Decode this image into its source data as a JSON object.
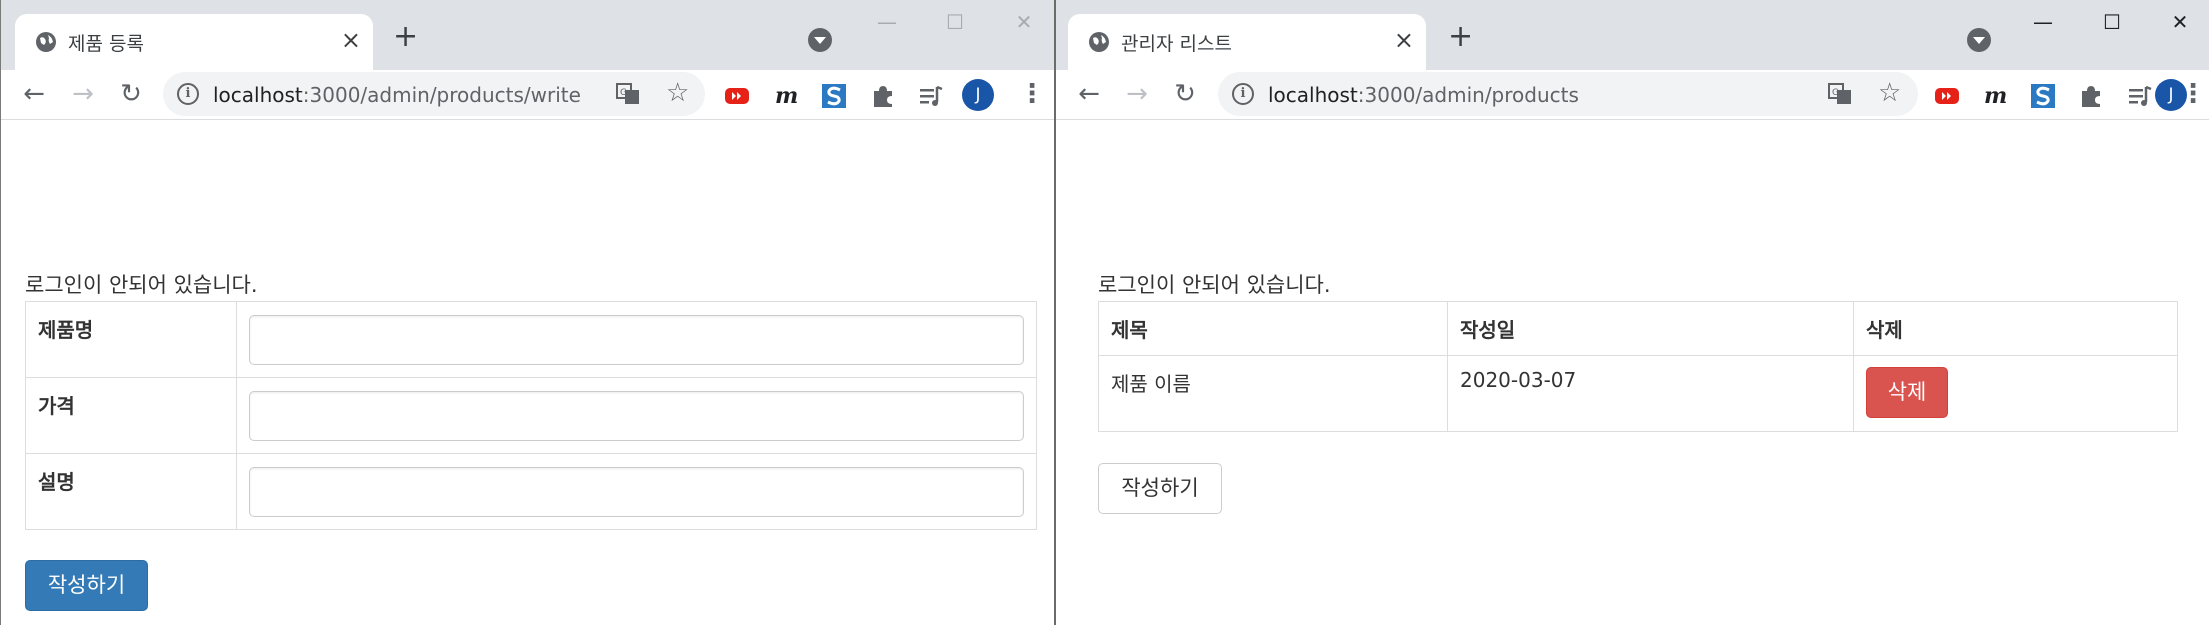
{
  "left_window": {
    "tab": {
      "title": "제품 등록",
      "close": "×"
    },
    "new_tab": "+",
    "window_controls": {
      "minimize": "—",
      "maximize": "☐",
      "close": "✕"
    },
    "url": {
      "host": "localhost",
      "path": ":3000/admin/products/write"
    },
    "avatar": "J",
    "login_message": "로그인이 안되어 있습니다.",
    "form": {
      "rows": [
        {
          "label": "제품명",
          "value": ""
        },
        {
          "label": "가격",
          "value": ""
        },
        {
          "label": "설명",
          "value": ""
        }
      ],
      "submit_label": "작성하기"
    }
  },
  "right_window": {
    "tab": {
      "title": "관리자 리스트",
      "close": "×"
    },
    "new_tab": "+",
    "window_controls": {
      "minimize": "—",
      "maximize": "☐",
      "close": "✕"
    },
    "url": {
      "host": "localhost",
      "path": ":3000/admin/products"
    },
    "avatar": "J",
    "login_message": "로그인이 안되어 있습니다.",
    "table": {
      "headers": [
        "제목",
        "작성일",
        "삭제"
      ],
      "rows": [
        {
          "title": "제품 이름",
          "date": "2020-03-07",
          "delete_label": "삭제"
        }
      ]
    },
    "write_label": "작성하기"
  },
  "icons": {
    "globe": "globe-icon",
    "back": "arrow-left-icon",
    "forward": "arrow-right-icon",
    "reload": "reload-icon",
    "info": "info-icon",
    "translate": "translate-icon",
    "star": "star-icon",
    "extensions": [
      "youtube-icon",
      "m-icon",
      "s-icon",
      "puzzle-icon",
      "playlist-icon"
    ],
    "menu": "kebab-menu-icon"
  },
  "colors": {
    "primary": "#337ab7",
    "danger": "#d9534f",
    "tabstrip": "#dee1e6",
    "avatar": "#1a56a8"
  }
}
